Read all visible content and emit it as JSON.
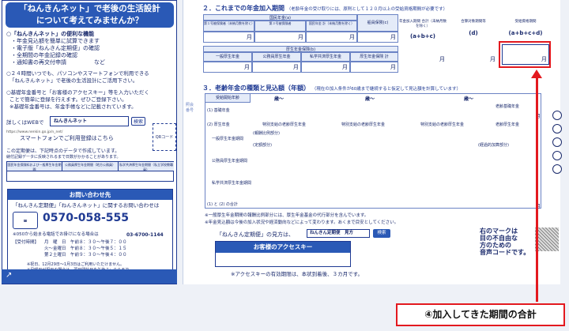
{
  "left": {
    "title_line1": "「ねんきんネット」で老後の生活設計",
    "title_line2": "について考えてみませんか？",
    "lines": [
      "○「ねんきんネット」の便利な機能",
      "・年金見込額を簡単に試算できます",
      "・電子版「ねんきん定期便」の確認",
      "・全期間の年金記録の確認",
      "・通知書の再交付申請　　　　　など",
      "○２４時間いつでも、パソコンやスマートフォンで利用できる",
      "「ねんきんネット」で老後の生活設計にご活用下さい。",
      "○基礎年金番号と「お客様のアクセスキー」等を入力いただく",
      "ことで簡単に登録を行えます。ぜひご登録下さい。",
      "※基礎年金番号は、年金手帳などに記載されています。"
    ],
    "search_prefix": "詳しくはWEBで",
    "search_value": "ねんきんネット",
    "search_button": "検索",
    "url": "https://www.nenkin.go.jp/n_net/",
    "smartphone_text": "スマートフォンでご利用登録はこちら",
    "qr_label": "QRコード",
    "note1": "この定期便は、下記時点のデータで作成しています。",
    "note2": "納付記録データに反映されるまで日数がかかることがあります。",
    "small_table": [
      "国民年金保険料および一般厚生年金期間",
      "公務員厚生年金期間（地方公務員）",
      "私学共済厚生年金期間（私立学校教職員）"
    ],
    "contact": {
      "header": "お問い合わせ先",
      "line": "「ねんきん定期便」「ねんきんネット」に関するお問い合わせは",
      "phone": "0570-058-555",
      "phone_note": "※050から始まる電話でお掛けになる場合は",
      "phone2": "03-6700-1144",
      "hours_label": "【受付時間】",
      "hours": [
        "月　曜　日　午前８：３０～午後７：００",
        "火～金曜日　午前８：３０～午後５：１５",
        "第２土曜日　午前９：３０～午後４：００"
      ],
      "footnote1": "※祝日、12月29日～1月3日はご利用いただけません。",
      "footnote2": "※月曜日が祝日の場合は、翌日開始日を午後７：００まで。"
    }
  },
  "main": {
    "section2_title": "２．これまでの年金加入期間",
    "section2_note": "（老齢年金の受け取りには、原則として１２０月以上の受給資格期間が必要です）",
    "national_label": "国民年金(a)",
    "national_cols": [
      "第１号被保険者（未納月数を除く）",
      "第３号被保険者",
      "国民年金 計（未納月数を除く）"
    ],
    "seaman_label": "船員保険(c)",
    "total_label": "年金加入期間 合計（未納月数を除く）",
    "total_formula": "(a+b+c)",
    "combined_label": "合算対象期間等",
    "combined_key": "(d)",
    "qual_label": "受給資格期間",
    "qual_formula": "(a+b+c+d)",
    "kosei_label": "厚生年金保険(b)",
    "kosei_cols": [
      "一般厚生年金",
      "公務員厚生年金",
      "私学共済厚生年金",
      "厚生年金保険 計"
    ],
    "unit": "月",
    "section3_title": "３．老齢年金の種類と見込額（年額）",
    "section3_note": "（現在の加入条件が60歳まで継続すると仮定して見込額を計算しています）",
    "age_header": "受給開始年齢",
    "age_unit": "歳〜",
    "rows": [
      "(1) 基礎年金",
      "(2) 厚生年金",
      "一般厚生年金期間",
      "公務員厚生年金期間",
      "私学共済厚生年金期間",
      "(1) と (2) の合計"
    ],
    "special_label": "特別支給の老齢厚生年金",
    "old_basic": "老齢基礎年金",
    "old_kosei": "老齢厚生年金",
    "sub_labels": [
      "(報酬比例部分)",
      "(定額部分)",
      "(経過的加算部分)"
    ],
    "note_a": "※一般厚生年金期間の報酬比例部分には、厚生年金基金の代行部分を含んでいます。",
    "note_b": "※年金見込額は今後の加入状況や経済動向などによって変わります。あくまで目安としてください。",
    "howto_prefix": "「ねんきん定期便」の見方は、",
    "howto_value": "ねんきん定期便　見方",
    "howto_button": "検索",
    "access_header": "お客様のアクセスキー",
    "access_note": "※アクセスキーの有効期限は、本状到着後、３カ月です。",
    "voice_text": [
      "右のマークは",
      "目の不自由な",
      "方のための",
      "音声コードです。"
    ],
    "side_vertical": "照会番号"
  },
  "callout": "④加入してきた期間の合計",
  "colors": {
    "accent": "#2a59b6",
    "highlight": "#e3191f"
  }
}
